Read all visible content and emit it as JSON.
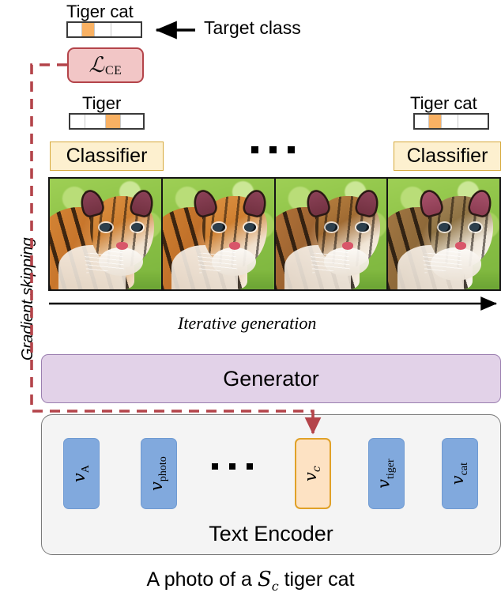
{
  "figure": {
    "target_class_label": "Target class",
    "gradient_skipping_label": "Gradient skipping",
    "iterative_generation_label": "Iterative generation",
    "caption_prefix": "A photo of a ",
    "caption_symbol": "S",
    "caption_symbol_sub": "c",
    "caption_suffix": " tiger cat",
    "ellipsis_glyph": "▪"
  },
  "target": {
    "bar_label": "Tiger cat",
    "segments": [
      {
        "fill": "#ffffff",
        "flex": 1.1
      },
      {
        "fill": "#f9b163",
        "flex": 1.0
      },
      {
        "fill": "#ffffff",
        "flex": 1.3
      },
      {
        "fill": "#ffffff",
        "flex": 2.4
      }
    ],
    "highlight_index": 1
  },
  "loss": {
    "symbol": "ℒ",
    "subscript": "CE"
  },
  "classifiers": [
    {
      "name": "classifier-left",
      "bar_label": "Tiger",
      "button_label": "Classifier",
      "segments": [
        {
          "fill": "#ffffff",
          "flex": 1.0
        },
        {
          "fill": "#ffffff",
          "flex": 1.4
        },
        {
          "fill": "#f9b163",
          "flex": 1.0
        },
        {
          "fill": "#ffffff",
          "flex": 1.6
        }
      ],
      "highlight_index": 2
    },
    {
      "name": "classifier-right",
      "bar_label": "Tiger cat",
      "button_label": "Classifier",
      "segments": [
        {
          "fill": "#ffffff",
          "flex": 1.1
        },
        {
          "fill": "#f9b163",
          "flex": 1.0
        },
        {
          "fill": "#ffffff",
          "flex": 1.3
        },
        {
          "fill": "#ffffff",
          "flex": 2.4
        }
      ],
      "highlight_index": 1
    }
  ],
  "image_strip": {
    "frames": [
      {
        "name": "generated-image-step-1",
        "alt": "tiger"
      },
      {
        "name": "generated-image-step-2",
        "alt": "tiger"
      },
      {
        "name": "generated-image-step-3",
        "alt": "tiger cat"
      },
      {
        "name": "generated-image-step-4",
        "alt": "tiger cat"
      }
    ]
  },
  "generator": {
    "label": "Generator"
  },
  "text_encoder": {
    "title": "Text Encoder",
    "tokens": [
      {
        "name": "token-v-a",
        "base": "v",
        "sub": "A",
        "style": "blue"
      },
      {
        "name": "token-v-photo",
        "base": "v",
        "sub": "photo",
        "style": "blue"
      },
      {
        "name": "token-v-c",
        "base": "v",
        "sub": "c",
        "style": "hl"
      },
      {
        "name": "token-v-tiger",
        "base": "v",
        "sub": "tiger",
        "style": "blue"
      },
      {
        "name": "token-v-cat",
        "base": "v",
        "sub": "cat",
        "style": "blue"
      }
    ]
  },
  "colors": {
    "loss_fill": "#f2c6c6",
    "loss_border": "#b4444a",
    "classifier_fill": "#fdf0cf",
    "classifier_border": "#d6a93b",
    "generator_fill": "#e2d2e8",
    "generator_border": "#9b7fb0",
    "encoder_fill": "#f4f4f4",
    "encoder_border": "#7a7a7a",
    "token_blue": "#81a9dd",
    "token_highlight": "#fde2c3",
    "token_highlight_border": "#e0a128",
    "bar_highlight": "#f9b163",
    "dash_line": "#b4444a"
  }
}
